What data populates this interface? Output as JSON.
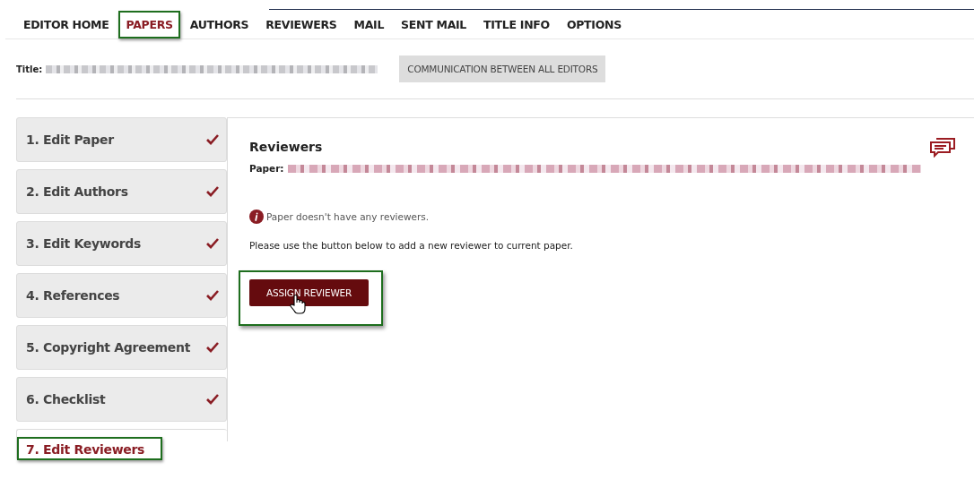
{
  "nav": [
    {
      "label": "EDITOR HOME",
      "selected": false,
      "highlighted": false
    },
    {
      "label": "PAPERS",
      "selected": true,
      "highlighted": true
    },
    {
      "label": "AUTHORS",
      "selected": false,
      "highlighted": false
    },
    {
      "label": "REVIEWERS",
      "selected": false,
      "highlighted": false
    },
    {
      "label": "MAIL",
      "selected": false,
      "highlighted": false
    },
    {
      "label": "SENT MAIL",
      "selected": false,
      "highlighted": false
    },
    {
      "label": "TITLE INFO",
      "selected": false,
      "highlighted": false
    },
    {
      "label": "OPTIONS",
      "selected": false,
      "highlighted": false
    }
  ],
  "title_row": {
    "label": "Title:",
    "button": "COMMUNICATION BETWEEN ALL EDITORS"
  },
  "steps": [
    {
      "label": "1. Edit Paper",
      "completed": true,
      "selected": false,
      "highlighted": false
    },
    {
      "label": "2. Edit Authors",
      "completed": true,
      "selected": false,
      "highlighted": false
    },
    {
      "label": "3. Edit Keywords",
      "completed": true,
      "selected": false,
      "highlighted": false
    },
    {
      "label": "4. References",
      "completed": true,
      "selected": false,
      "highlighted": false
    },
    {
      "label": "5. Copyright Agreement",
      "completed": true,
      "selected": false,
      "highlighted": false
    },
    {
      "label": "6. Checklist",
      "completed": true,
      "selected": false,
      "highlighted": false
    },
    {
      "label": "7. Edit Reviewers",
      "completed": false,
      "selected": true,
      "highlighted": true
    }
  ],
  "panel": {
    "heading": "Reviewers",
    "paper_label": "Paper:",
    "notice": "Paper doesn't have any reviewers.",
    "instruction": "Please use the button below to add a new reviewer to current paper.",
    "button": {
      "label": "ASSIGN REVIEWER",
      "highlighted": true
    }
  }
}
